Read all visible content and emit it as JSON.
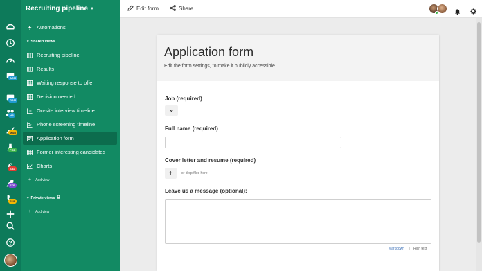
{
  "rail": {
    "items": [
      {
        "icon": "dashboard-icon",
        "badge": ""
      },
      {
        "icon": "clock-icon",
        "badge": ""
      },
      {
        "icon": "speedometer-icon",
        "badge": ""
      },
      {
        "icon": "crm-icon",
        "badge": "ACM",
        "badge_color": "#1f9bd1"
      },
      {
        "icon": "crm-icon",
        "badge": "RDM",
        "badge_color": "#1f9bd1"
      },
      {
        "icon": "people-icon",
        "badge": "HR",
        "badge_color": "#1f9bd1"
      },
      {
        "icon": "chart-icon",
        "badge": "MAR",
        "badge_color": "#f2b705"
      },
      {
        "icon": "flask-icon",
        "badge": "PRD",
        "badge_color": "#3cb44b"
      },
      {
        "icon": "euro-icon",
        "badge": "SAL",
        "badge_color": "#e03c31"
      },
      {
        "icon": "rocket-icon",
        "badge": "STR",
        "badge_color": "#7b4bd1"
      },
      {
        "icon": "phone-icon",
        "badge": "SUP",
        "badge_color": "#f2b705"
      },
      {
        "icon": "plus-icon",
        "badge": ""
      },
      {
        "icon": "search-icon",
        "badge": ""
      },
      {
        "icon": "help-icon",
        "badge": ""
      }
    ]
  },
  "sidebar": {
    "title": "Recruiting pipeline",
    "automations": "Automations",
    "shared_section": "Shared views",
    "views": [
      {
        "label": "Recruiting pipeline",
        "icon": "kanban-icon"
      },
      {
        "label": "Results",
        "icon": "kanban-icon"
      },
      {
        "label": "Waiting response to offer",
        "icon": "grid-icon"
      },
      {
        "label": "Decision needed",
        "icon": "grid-icon"
      },
      {
        "label": "On-site interview timeline",
        "icon": "timeline-icon"
      },
      {
        "label": "Phone screening timeline",
        "icon": "timeline-icon"
      },
      {
        "label": "Application form",
        "icon": "form-icon"
      },
      {
        "label": "Former interesting candidates",
        "icon": "grid-icon"
      },
      {
        "label": "Charts",
        "icon": "chart-icon"
      }
    ],
    "add_view": "Add view",
    "private_section": "Private views",
    "add_view_private": "Add view"
  },
  "topbar": {
    "edit_form": "Edit form",
    "share": "Share"
  },
  "form": {
    "title": "Application form",
    "subtitle": "Edit the form settings, to make it publicly accessible",
    "job_label": "Job (required)",
    "fullname_label": "Full name (required)",
    "cover_label": "Cover letter and resume (required)",
    "upload_symbol": "+",
    "drop_text": "or drop files here",
    "message_label": "Leave us a message (optional):",
    "mode_markdown": "Markdown",
    "mode_separator": "|",
    "mode_rich": "Rich text"
  },
  "colors": {
    "rail": "#0d7a5a",
    "sidebar": "#128a63",
    "active": "#0c6c4d",
    "link": "#3b6fb6"
  }
}
